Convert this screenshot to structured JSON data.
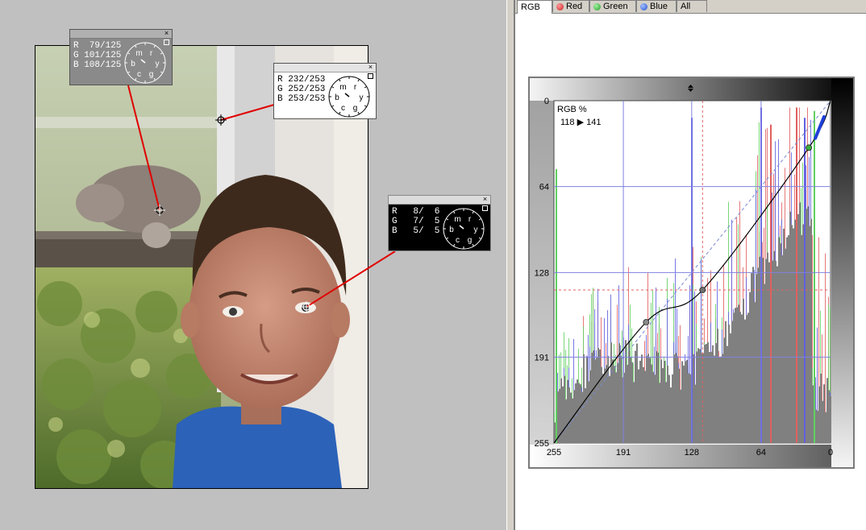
{
  "probes": [
    {
      "id": "probe-gray",
      "theme": "gray",
      "r": "R  79/125",
      "g": "G 101/125",
      "b": "B 108/125"
    },
    {
      "id": "probe-white",
      "theme": "white",
      "r": "R 232/253",
      "g": "G 252/253",
      "b": "B 253/253"
    },
    {
      "id": "probe-black",
      "theme": "black",
      "r": "R   8/  6",
      "g": "G   7/  5",
      "b": "B   5/  5"
    }
  ],
  "dial_letters": [
    "r",
    "y",
    "g",
    "c",
    "b",
    "m"
  ],
  "close_glyph": "×",
  "tabs": [
    {
      "label": "RGB",
      "color": null,
      "active": true
    },
    {
      "label": "Red",
      "color": "#cc2020",
      "active": false
    },
    {
      "label": "Green",
      "color": "#20a020",
      "active": false
    },
    {
      "label": "Blue",
      "color": "#2050cc",
      "active": false
    },
    {
      "label": "All",
      "color": null,
      "active": false
    }
  ],
  "curve": {
    "title": "RGB %",
    "readout": "118 ▶ 141",
    "y_ticks": [
      "0",
      "64",
      "128",
      "191",
      "255"
    ],
    "x_ticks": [
      "255",
      "191",
      "128",
      "64",
      "0"
    ],
    "colors": {
      "grid": "#8080e0",
      "ref": "#e06060",
      "curve": "#000000",
      "hist_gray": "#808080",
      "hist_red": "#e06060",
      "hist_green": "#60d060",
      "hist_blue": "#6060e0"
    }
  }
}
